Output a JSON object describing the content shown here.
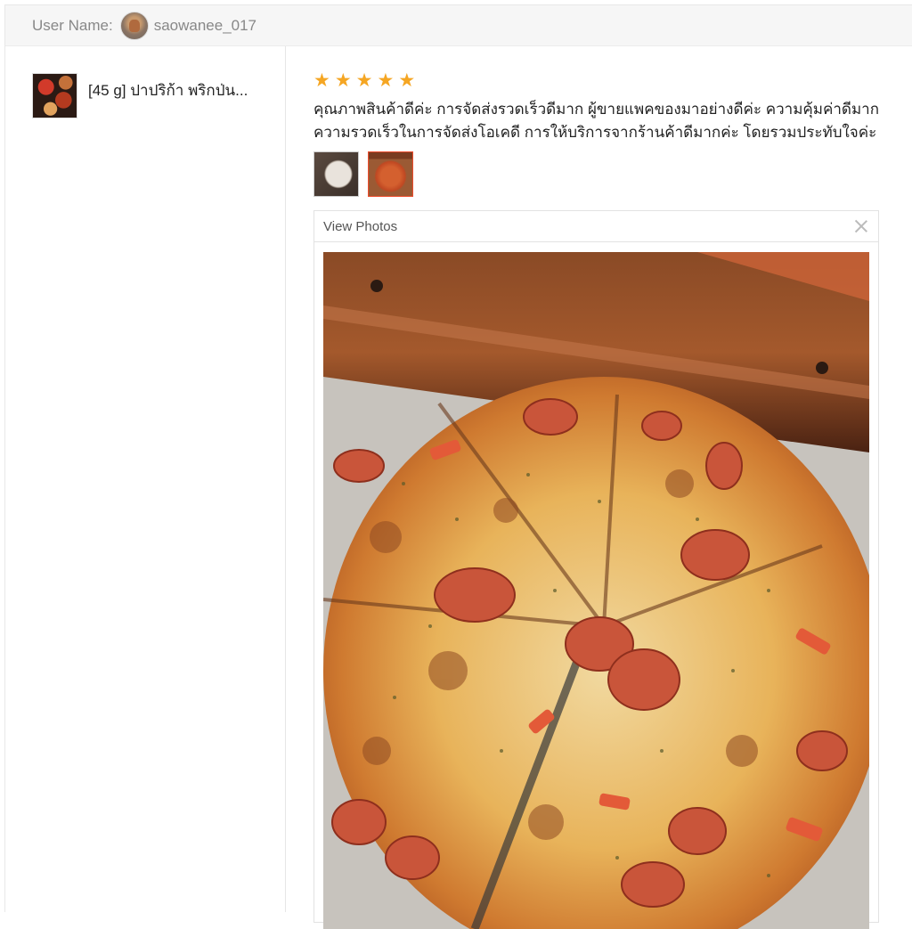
{
  "header": {
    "label": "User Name:",
    "username": "saowanee_017",
    "avatar_icon": "user-avatar"
  },
  "product": {
    "name": "[45 g] ปาปริก้า พริกป่น...",
    "thumbnail_icon": "product-thumbnail"
  },
  "review": {
    "rating": 5,
    "stars": [
      "★",
      "★",
      "★",
      "★",
      "★"
    ],
    "text": "คุณภาพสินค้าดีค่ะ การจัดส่งรวดเร็วดีมาก ผู้ขายแพคของมาอย่างดีค่ะ ความคุ้มค่าดีมาก ความรวดเร็วในการจัดส่งโอเคดี การให้บริการจากร้านค้าดีมากค่ะ โดยรวมประทับใจค่ะ",
    "photo_count": 2,
    "selected_photo": 2
  },
  "viewer": {
    "title": "View Photos",
    "close_icon": "close-icon"
  },
  "colors": {
    "star": "#f5a623",
    "header_bg": "#f6f6f6",
    "accent": "#ee4d2d"
  }
}
